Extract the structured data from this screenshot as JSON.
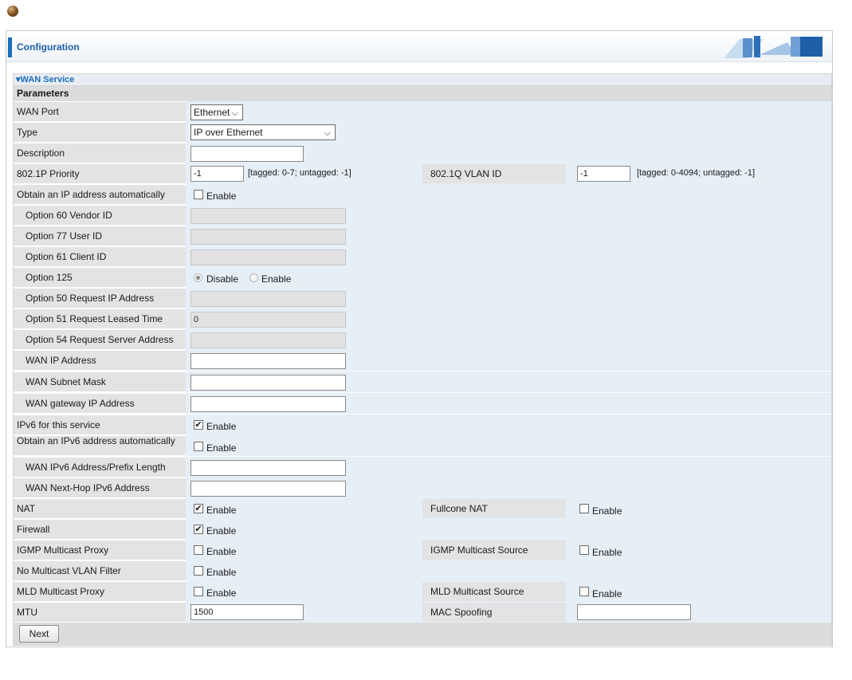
{
  "header": {
    "title": "Configuration"
  },
  "section": {
    "title": "▾WAN Service",
    "params_title": "Parameters"
  },
  "fields": {
    "wan_port": {
      "label": "WAN Port",
      "value": "Ethernet"
    },
    "type": {
      "label": "Type",
      "value": "IP over Ethernet"
    },
    "description": {
      "label": "Description",
      "value": ""
    },
    "priority": {
      "label": "802.1P Priority",
      "value": "-1",
      "hint": "[tagged: 0-7; untagged: -1]"
    },
    "vlan_id": {
      "label": "802.1Q VLAN ID",
      "value": "-1",
      "hint": "[tagged: 0-4094; untagged: -1]"
    },
    "obtain_ip": {
      "label": "Obtain an IP address automatically",
      "enable": "Enable",
      "checked": false
    },
    "opt60": {
      "label": "Option 60 Vendor ID",
      "value": ""
    },
    "opt77": {
      "label": "Option 77 User ID",
      "value": ""
    },
    "opt61": {
      "label": "Option 61 Client ID",
      "value": ""
    },
    "opt125": {
      "label": "Option 125",
      "disable": "Disable",
      "enable": "Enable",
      "selected": "Disable"
    },
    "opt50": {
      "label": "Option 50 Request IP Address",
      "value": ""
    },
    "opt51": {
      "label": "Option 51 Request Leased Time",
      "value": "0"
    },
    "opt54": {
      "label": "Option 54 Request Server Address",
      "value": ""
    },
    "wan_ip": {
      "label": "WAN IP Address",
      "value": ""
    },
    "wan_mask": {
      "label": "WAN Subnet Mask",
      "value": ""
    },
    "wan_gw": {
      "label": "WAN gateway IP Address",
      "value": ""
    },
    "ipv6": {
      "label": "IPv6 for this service",
      "enable": "Enable",
      "checked": true
    },
    "obtain_ipv6": {
      "label": "Obtain an IPv6 address automatically",
      "enable": "Enable",
      "checked": false
    },
    "ipv6_addr": {
      "label": "WAN IPv6 Address/Prefix Length",
      "value": ""
    },
    "ipv6_hop": {
      "label": "WAN Next-Hop IPv6 Address",
      "value": ""
    },
    "nat": {
      "label": "NAT",
      "enable": "Enable",
      "checked": true
    },
    "fullcone": {
      "label": "Fullcone NAT",
      "enable": "Enable",
      "checked": false
    },
    "firewall": {
      "label": "Firewall",
      "enable": "Enable",
      "checked": true
    },
    "igmp_proxy": {
      "label": "IGMP Multicast Proxy",
      "enable": "Enable",
      "checked": false
    },
    "igmp_source": {
      "label": "IGMP Multicast Source",
      "enable": "Enable",
      "checked": false
    },
    "no_vlan_filter": {
      "label": "No Multicast VLAN Filter",
      "enable": "Enable",
      "checked": false
    },
    "mld_proxy": {
      "label": "MLD Multicast Proxy",
      "enable": "Enable",
      "checked": false
    },
    "mld_source": {
      "label": "MLD Multicast Source",
      "enable": "Enable",
      "checked": false
    },
    "mtu": {
      "label": "MTU",
      "value": "1500"
    },
    "mac_spoof": {
      "label": "MAC Spoofing",
      "value": ""
    }
  },
  "buttons": {
    "next": "Next"
  },
  "check_mark": "✔",
  "chevron": "⌵"
}
